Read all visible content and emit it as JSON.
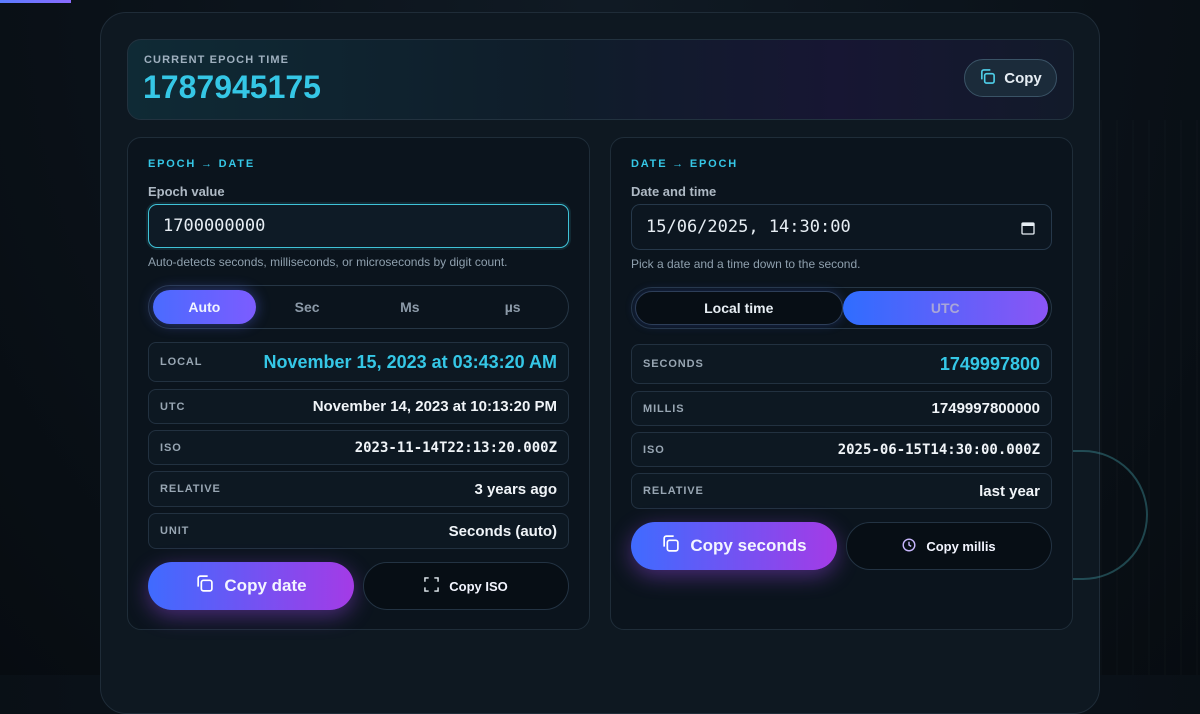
{
  "current": {
    "label": "CURRENT EPOCH TIME",
    "value": "1787945175",
    "copy_label": "Copy"
  },
  "left": {
    "title": "EPOCH → DATE",
    "field_label": "Epoch value",
    "input_value": "1700000000",
    "hint": "Auto-detects seconds, milliseconds, or microseconds by digit count.",
    "units": [
      "Auto",
      "Sec",
      "Ms",
      "µs"
    ],
    "active_unit": "Auto",
    "rows": [
      {
        "key": "LOCAL",
        "value": "November 15, 2023 at 03:43:20 AM"
      },
      {
        "key": "UTC",
        "value": "November 14, 2023 at 10:13:20 PM"
      },
      {
        "key": "ISO",
        "value": "2023-11-14T22:13:20.000Z"
      },
      {
        "key": "RELATIVE",
        "value": "3 years ago"
      },
      {
        "key": "UNIT",
        "value": "Seconds (auto)"
      }
    ],
    "copy_date_label": "Copy date",
    "copy_iso_label": "Copy ISO"
  },
  "right": {
    "title": "DATE → EPOCH",
    "field_label": "Date and time",
    "date_value": "15/06/2025, 14:30:00",
    "hint": "Pick a date and a time down to the second.",
    "modes": [
      "Local time",
      "UTC"
    ],
    "active_mode": "Local time",
    "rows": [
      {
        "key": "SECONDS",
        "value": "1749997800"
      },
      {
        "key": "MILLIS",
        "value": "1749997800000"
      },
      {
        "key": "ISO",
        "value": "2025-06-15T14:30:00.000Z"
      },
      {
        "key": "RELATIVE",
        "value": "last year"
      }
    ],
    "copy_seconds_label": "Copy seconds",
    "copy_millis_label": "Copy millis"
  },
  "colors": {
    "accent_cyan": "#35c7e6",
    "gradient_start": "#3f6bff",
    "gradient_end": "#a43be6"
  }
}
